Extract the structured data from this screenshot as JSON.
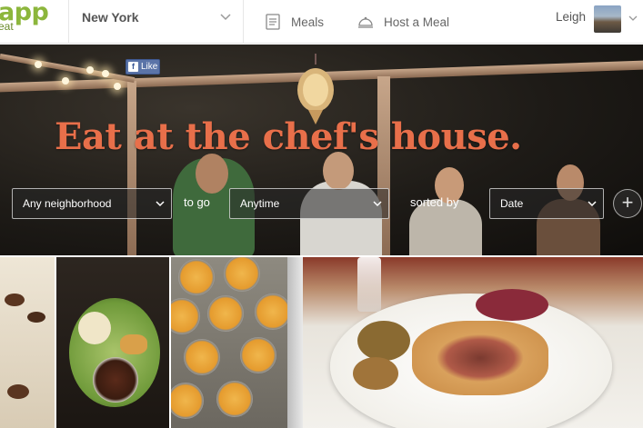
{
  "header": {
    "logo_main": "app",
    "logo_sub": "eat",
    "city": "New York",
    "nav": {
      "meals_label": "Meals",
      "host_label": "Host a Meal"
    },
    "user_name": "Leigh"
  },
  "hero": {
    "fb_like": "Like",
    "headline": "Eat at the chef's house.",
    "filters": {
      "neighborhood": "Any neighborhood",
      "to_go_label": "to go",
      "time": "Anytime",
      "sorted_by_label": "sorted by",
      "sort": "Date",
      "plus": "+"
    }
  },
  "colors": {
    "brand_green": "#8cb63c",
    "headline_orange": "#e86f4a"
  },
  "icons": {
    "meals": "meals-menu-icon",
    "host": "host-cloche-icon",
    "chevron": "chevron-down-icon",
    "facebook": "facebook-icon",
    "plus": "plus-icon"
  }
}
